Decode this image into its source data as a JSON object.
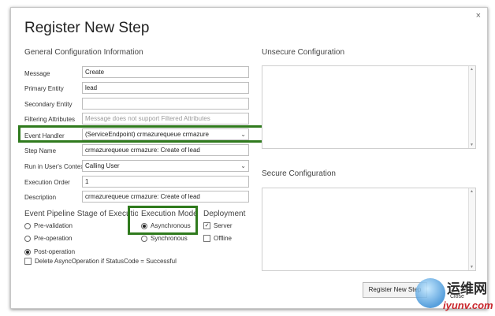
{
  "dialog": {
    "title": "Register New Step",
    "close_glyph": "×",
    "general_section": "General Configuration Information",
    "unsecure_section": "Unsecure  Configuration",
    "secure_section": "Secure  Configuration"
  },
  "fields": {
    "message": {
      "label": "Message",
      "value": "Create"
    },
    "primary_entity": {
      "label": "Primary Entity",
      "value": "lead"
    },
    "secondary_entity": {
      "label": "Secondary Entity",
      "value": ""
    },
    "filtering_attributes": {
      "label": "Filtering Attributes",
      "placeholder": "Message does not support Filtered Attributes"
    },
    "event_handler": {
      "label": "Event Handler",
      "value": "(ServiceEndpoint) crmazurequeue crmazure"
    },
    "step_name": {
      "label": "Step Name",
      "value": "crmazurequeue crmazure: Create of lead"
    },
    "run_in_users_context": {
      "label": "Run in User's Context",
      "value": "Calling User"
    },
    "execution_order": {
      "label": "Execution Order",
      "value": "1"
    },
    "description": {
      "label": "Description",
      "value": "crmazurequeue crmazure: Create of lead"
    }
  },
  "pipeline": {
    "heading": "Event Pipeline Stage of Execution",
    "options": [
      {
        "label": "Pre-validation",
        "selected": false
      },
      {
        "label": "Pre-operation",
        "selected": false
      },
      {
        "label": "Post-operation",
        "selected": true
      }
    ],
    "delete_async": {
      "label": "Delete AsyncOperation if StatusCode = Successful",
      "checked": false
    }
  },
  "execution_mode": {
    "heading": "Execution Mode",
    "options": [
      {
        "label": "Asynchronous",
        "selected": true
      },
      {
        "label": "Synchronous",
        "selected": false
      }
    ]
  },
  "deployment": {
    "heading": "Deployment",
    "server": {
      "label": "Server",
      "checked": true
    },
    "offline": {
      "label": "Offline",
      "checked": false
    }
  },
  "footer": {
    "register_button": "Register New Step",
    "close_label": "Close"
  },
  "watermark": {
    "chinese_text": "运维网",
    "domain": "iyunv.com"
  },
  "colors": {
    "highlight": "#2f7a1d"
  }
}
